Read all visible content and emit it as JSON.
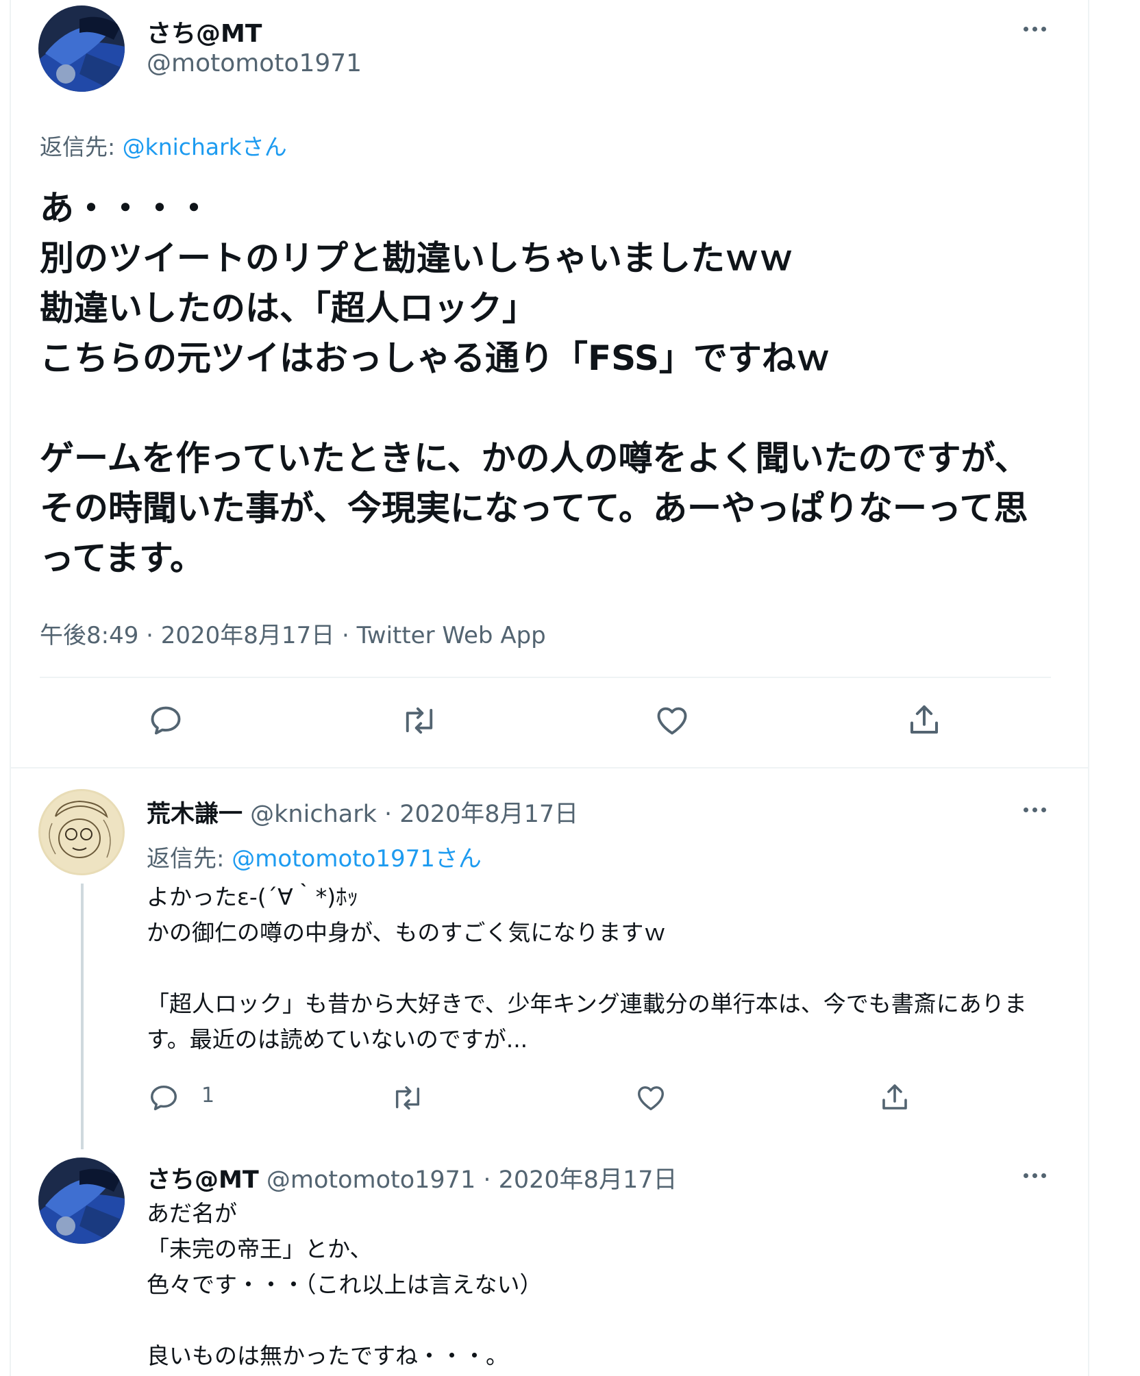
{
  "main_tweet": {
    "display_name": "さち@MT",
    "handle": "@motomoto1971",
    "reply_to_label": "返信先: ",
    "reply_to_handle": "@knicharkさん",
    "text": "あ・・・・\n別のツイートのリプと勘違いしちゃいましたｗｗ\n勘違いしたのは、「超人ロック」\nこちらの元ツイはおっしゃる通り「FSS」ですねｗ\n\nゲームを作っていたときに、かの人の噂をよく聞いたのですが、その時聞いた事が、今現実になってて。あーやっぱりなーって思ってます。",
    "meta": "午後8:49 · 2020年8月17日 · Twitter Web App",
    "icons": [
      "reply-icon",
      "retweet-icon",
      "like-icon",
      "share-icon"
    ]
  },
  "reply1": {
    "display_name": "荒木謙一",
    "handle_date": "@knichark · 2020年8月17日",
    "reply_to_label": "返信先: ",
    "reply_to_handle": "@motomoto1971さん",
    "text": "よかったε-(´∀｀*)ﾎｯ\nかの御仁の噂の中身が、ものすごく気になりますｗ\n\n「超人ロック」も昔から大好きで、少年キング連載分の単行本は、今でも書斎にあります。最近のは読めていないのですが...",
    "reply_count": "1"
  },
  "reply2": {
    "display_name": "さち@MT",
    "handle_date": "@motomoto1971 · 2020年8月17日",
    "text": "あだ名が\n「未完の帝王」とか、\n色々です・・・（これ以上は言えない）\n\n良いものは無かったですね・・・。"
  },
  "colors": {
    "text": "#0f1419",
    "secondary": "#536471",
    "link": "#1d9bf0",
    "divider": "#eff3f4",
    "thread_line": "#cfd9de"
  }
}
